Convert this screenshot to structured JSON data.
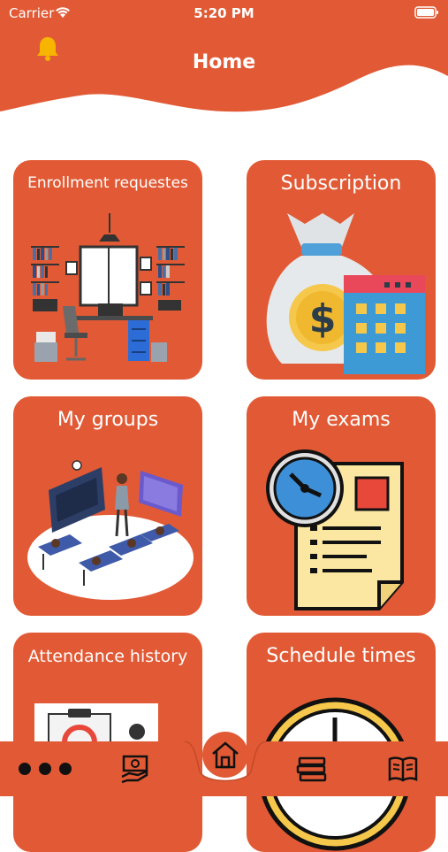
{
  "status_bar": {
    "carrier": "Carrier",
    "time": "5:20 PM"
  },
  "header": {
    "title": "Home",
    "bell_icon": "bell-icon"
  },
  "colors": {
    "accent": "#e15a35",
    "bell": "#f7b500",
    "background": "#ffffff"
  },
  "cards": [
    {
      "title": "Enrollment requestes",
      "icon": "office-illustration"
    },
    {
      "title": "Subscription",
      "icon": "money-bag-calendar-illustration"
    },
    {
      "title": "My groups",
      "icon": "classroom-illustration"
    },
    {
      "title": "My exams",
      "icon": "exam-clock-document-illustration"
    },
    {
      "title": "Attendance history",
      "icon": "attendance-illustration"
    },
    {
      "title": "Schedule times",
      "icon": "clock-illustration"
    }
  ],
  "tabbar": {
    "items": [
      {
        "icon": "more-dots-icon"
      },
      {
        "icon": "payment-icon"
      },
      {
        "icon": "home-icon"
      },
      {
        "icon": "books-stack-icon"
      },
      {
        "icon": "open-book-icon"
      }
    ]
  }
}
